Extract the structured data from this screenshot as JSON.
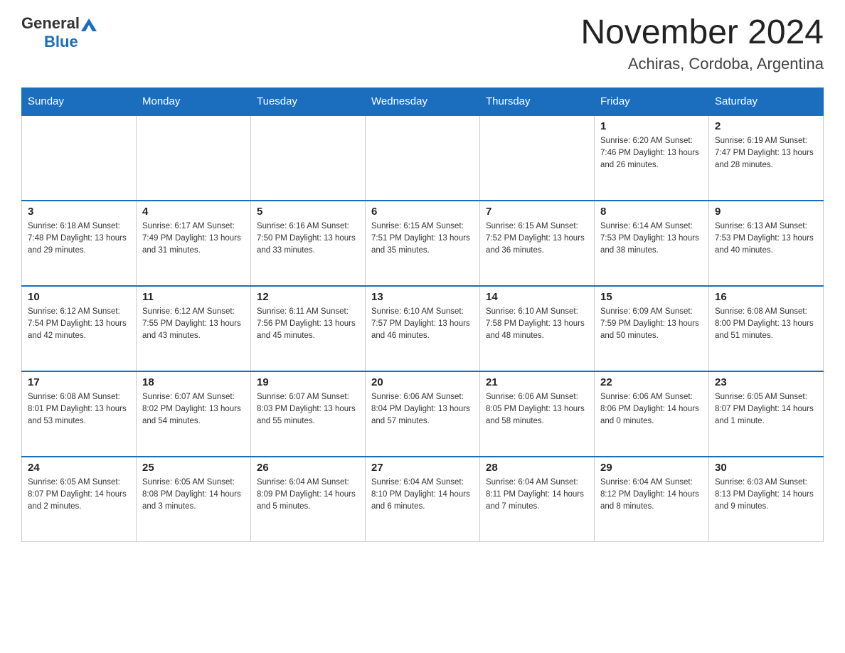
{
  "header": {
    "logo_general": "General",
    "logo_blue": "Blue",
    "month_title": "November 2024",
    "location": "Achiras, Cordoba, Argentina"
  },
  "days_of_week": [
    "Sunday",
    "Monday",
    "Tuesday",
    "Wednesday",
    "Thursday",
    "Friday",
    "Saturday"
  ],
  "weeks": [
    [
      {
        "day": "",
        "info": ""
      },
      {
        "day": "",
        "info": ""
      },
      {
        "day": "",
        "info": ""
      },
      {
        "day": "",
        "info": ""
      },
      {
        "day": "",
        "info": ""
      },
      {
        "day": "1",
        "info": "Sunrise: 6:20 AM\nSunset: 7:46 PM\nDaylight: 13 hours\nand 26 minutes."
      },
      {
        "day": "2",
        "info": "Sunrise: 6:19 AM\nSunset: 7:47 PM\nDaylight: 13 hours\nand 28 minutes."
      }
    ],
    [
      {
        "day": "3",
        "info": "Sunrise: 6:18 AM\nSunset: 7:48 PM\nDaylight: 13 hours\nand 29 minutes."
      },
      {
        "day": "4",
        "info": "Sunrise: 6:17 AM\nSunset: 7:49 PM\nDaylight: 13 hours\nand 31 minutes."
      },
      {
        "day": "5",
        "info": "Sunrise: 6:16 AM\nSunset: 7:50 PM\nDaylight: 13 hours\nand 33 minutes."
      },
      {
        "day": "6",
        "info": "Sunrise: 6:15 AM\nSunset: 7:51 PM\nDaylight: 13 hours\nand 35 minutes."
      },
      {
        "day": "7",
        "info": "Sunrise: 6:15 AM\nSunset: 7:52 PM\nDaylight: 13 hours\nand 36 minutes."
      },
      {
        "day": "8",
        "info": "Sunrise: 6:14 AM\nSunset: 7:53 PM\nDaylight: 13 hours\nand 38 minutes."
      },
      {
        "day": "9",
        "info": "Sunrise: 6:13 AM\nSunset: 7:53 PM\nDaylight: 13 hours\nand 40 minutes."
      }
    ],
    [
      {
        "day": "10",
        "info": "Sunrise: 6:12 AM\nSunset: 7:54 PM\nDaylight: 13 hours\nand 42 minutes."
      },
      {
        "day": "11",
        "info": "Sunrise: 6:12 AM\nSunset: 7:55 PM\nDaylight: 13 hours\nand 43 minutes."
      },
      {
        "day": "12",
        "info": "Sunrise: 6:11 AM\nSunset: 7:56 PM\nDaylight: 13 hours\nand 45 minutes."
      },
      {
        "day": "13",
        "info": "Sunrise: 6:10 AM\nSunset: 7:57 PM\nDaylight: 13 hours\nand 46 minutes."
      },
      {
        "day": "14",
        "info": "Sunrise: 6:10 AM\nSunset: 7:58 PM\nDaylight: 13 hours\nand 48 minutes."
      },
      {
        "day": "15",
        "info": "Sunrise: 6:09 AM\nSunset: 7:59 PM\nDaylight: 13 hours\nand 50 minutes."
      },
      {
        "day": "16",
        "info": "Sunrise: 6:08 AM\nSunset: 8:00 PM\nDaylight: 13 hours\nand 51 minutes."
      }
    ],
    [
      {
        "day": "17",
        "info": "Sunrise: 6:08 AM\nSunset: 8:01 PM\nDaylight: 13 hours\nand 53 minutes."
      },
      {
        "day": "18",
        "info": "Sunrise: 6:07 AM\nSunset: 8:02 PM\nDaylight: 13 hours\nand 54 minutes."
      },
      {
        "day": "19",
        "info": "Sunrise: 6:07 AM\nSunset: 8:03 PM\nDaylight: 13 hours\nand 55 minutes."
      },
      {
        "day": "20",
        "info": "Sunrise: 6:06 AM\nSunset: 8:04 PM\nDaylight: 13 hours\nand 57 minutes."
      },
      {
        "day": "21",
        "info": "Sunrise: 6:06 AM\nSunset: 8:05 PM\nDaylight: 13 hours\nand 58 minutes."
      },
      {
        "day": "22",
        "info": "Sunrise: 6:06 AM\nSunset: 8:06 PM\nDaylight: 14 hours\nand 0 minutes."
      },
      {
        "day": "23",
        "info": "Sunrise: 6:05 AM\nSunset: 8:07 PM\nDaylight: 14 hours\nand 1 minute."
      }
    ],
    [
      {
        "day": "24",
        "info": "Sunrise: 6:05 AM\nSunset: 8:07 PM\nDaylight: 14 hours\nand 2 minutes."
      },
      {
        "day": "25",
        "info": "Sunrise: 6:05 AM\nSunset: 8:08 PM\nDaylight: 14 hours\nand 3 minutes."
      },
      {
        "day": "26",
        "info": "Sunrise: 6:04 AM\nSunset: 8:09 PM\nDaylight: 14 hours\nand 5 minutes."
      },
      {
        "day": "27",
        "info": "Sunrise: 6:04 AM\nSunset: 8:10 PM\nDaylight: 14 hours\nand 6 minutes."
      },
      {
        "day": "28",
        "info": "Sunrise: 6:04 AM\nSunset: 8:11 PM\nDaylight: 14 hours\nand 7 minutes."
      },
      {
        "day": "29",
        "info": "Sunrise: 6:04 AM\nSunset: 8:12 PM\nDaylight: 14 hours\nand 8 minutes."
      },
      {
        "day": "30",
        "info": "Sunrise: 6:03 AM\nSunset: 8:13 PM\nDaylight: 14 hours\nand 9 minutes."
      }
    ]
  ]
}
